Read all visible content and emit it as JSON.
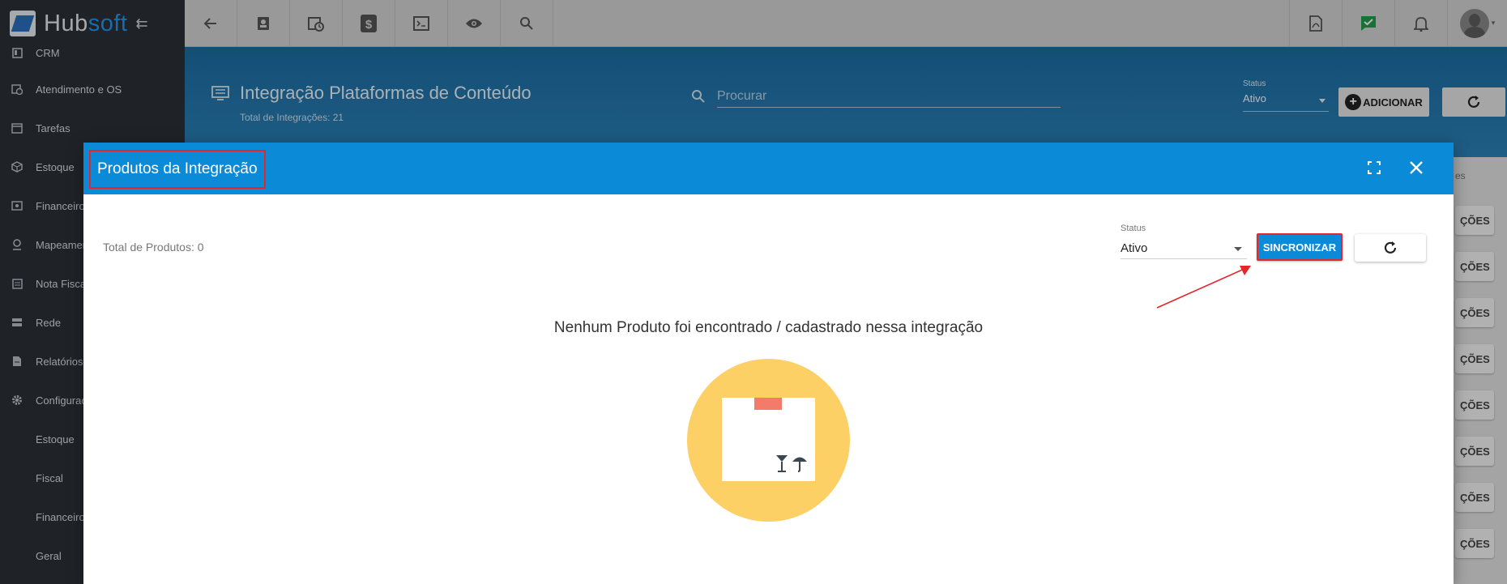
{
  "brand": {
    "name_part1": "Hub",
    "name_part2": "soft"
  },
  "sidebar": {
    "items": [
      {
        "label": "CRM",
        "icon": "board-icon"
      },
      {
        "label": "Atendimento e OS",
        "icon": "calendar-clock-icon"
      },
      {
        "label": "Tarefas",
        "icon": "calendar-icon"
      },
      {
        "label": "Estoque",
        "icon": "box-icon"
      },
      {
        "label": "Financeiro",
        "icon": "money-icon"
      },
      {
        "label": "Mapeamento",
        "icon": "map-pin-icon"
      },
      {
        "label": "Nota Fiscal",
        "icon": "list-icon"
      },
      {
        "label": "Rede",
        "icon": "server-icon"
      },
      {
        "label": "Relatórios",
        "icon": "report-icon"
      },
      {
        "label": "Configurações",
        "icon": "gear-icon"
      }
    ],
    "subitems": [
      {
        "label": "Estoque"
      },
      {
        "label": "Fiscal"
      },
      {
        "label": "Financeiro"
      },
      {
        "label": "Geral"
      }
    ]
  },
  "page": {
    "title": "Integração Plataformas de Conteúdo",
    "subtitle": "Total de Integrações: 21",
    "search_placeholder": "Procurar",
    "status_label": "Status",
    "status_value": "Ativo",
    "add_label": "ADICIONAR",
    "list_header": "es",
    "row_action_label": "ÇÕES"
  },
  "modal": {
    "title": "Produtos da Integração",
    "total_label": "Total de Produtos: 0",
    "status_label": "Status",
    "status_value": "Ativo",
    "sync_label": "SINCRONIZAR",
    "empty_message": "Nenhum Produto foi encontrado / cadastrado nessa integração"
  },
  "colors": {
    "sidebar_bg": "#2b3138",
    "modal_header": "#0b8ad8",
    "highlight": "#e5262b",
    "illustration": "#fdd066"
  }
}
